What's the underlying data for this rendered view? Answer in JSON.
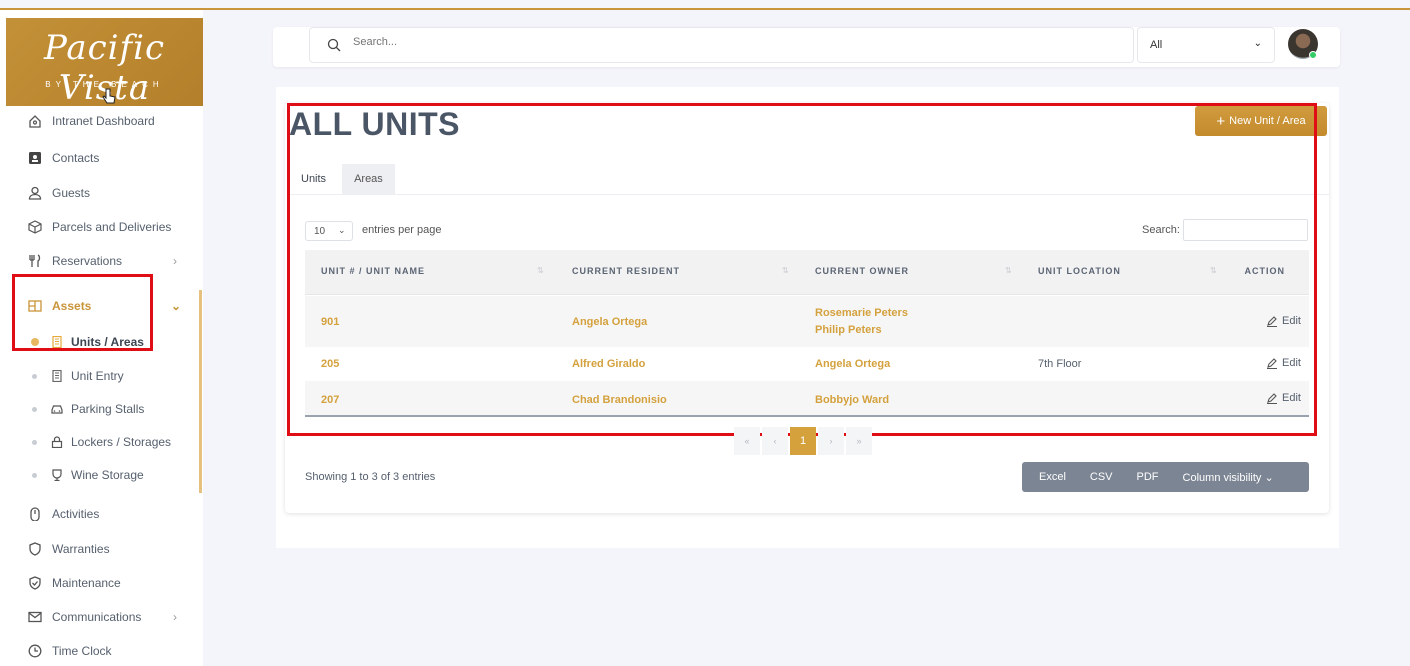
{
  "brand": {
    "name": "Pacific Vista",
    "tagline": "BY THE BEACH"
  },
  "colors": {
    "accent": "#c9953a",
    "highlight": "#e00d15",
    "export_bar": "#7c8593"
  },
  "sidebar": {
    "items": [
      {
        "label": "Intranet Dashboard",
        "icon": "home-icon"
      },
      {
        "label": "Contacts",
        "icon": "contact-card-icon"
      },
      {
        "label": "Guests",
        "icon": "user-icon"
      },
      {
        "label": "Parcels and Deliveries",
        "icon": "package-icon"
      },
      {
        "label": "Reservations",
        "icon": "utensils-icon",
        "chevron": ">"
      },
      {
        "label": "Assets",
        "icon": "assets-icon",
        "chevron": "v",
        "active": true
      },
      {
        "label": "Activities",
        "icon": "activity-icon"
      },
      {
        "label": "Warranties",
        "icon": "shield-icon"
      },
      {
        "label": "Maintenance",
        "icon": "maintenance-icon"
      },
      {
        "label": "Communications",
        "icon": "mail-icon",
        "chevron": ">"
      },
      {
        "label": "Time Clock",
        "icon": "clock-icon"
      }
    ],
    "subitems": [
      {
        "label": "Units / Areas",
        "icon": "building-icon",
        "active": true
      },
      {
        "label": "Unit Entry",
        "icon": "building-icon"
      },
      {
        "label": "Parking Stalls",
        "icon": "car-icon"
      },
      {
        "label": "Lockers / Storages",
        "icon": "lock-icon"
      },
      {
        "label": "Wine Storage",
        "icon": "wine-icon"
      }
    ]
  },
  "topbar": {
    "search_placeholder": "Search...",
    "scope": "All"
  },
  "page": {
    "title": "ALL UNITS",
    "new_button": "New Unit / Area",
    "tabs": [
      "Units",
      "Areas"
    ],
    "entries_value": "10",
    "entries_label": "entries per page",
    "search_label": "Search:"
  },
  "table": {
    "headers": [
      "UNIT # / UNIT NAME",
      "CURRENT RESIDENT",
      "CURRENT OWNER",
      "UNIT LOCATION",
      "ACTION"
    ],
    "rows": [
      {
        "unit": "901",
        "resident": "Angela Ortega",
        "owner1": "Rosemarie Peters",
        "owner2": "Philip Peters",
        "location": "",
        "action": "Edit"
      },
      {
        "unit": "205",
        "resident": "Alfred Giraldo",
        "owner1": "Angela Ortega",
        "owner2": "",
        "location": "7th Floor",
        "action": "Edit"
      },
      {
        "unit": "207",
        "resident": "Chad Brandonisio",
        "owner1": "Bobbyjo Ward",
        "owner2": "",
        "location": "",
        "action": "Edit"
      }
    ]
  },
  "pagination": {
    "first": "«",
    "prev": "‹",
    "current": "1",
    "next": "›",
    "last": "»"
  },
  "footer": {
    "showing": "Showing 1 to 3 of 3 entries",
    "exports": [
      "Excel",
      "CSV",
      "PDF",
      "Column visibility ⌄"
    ]
  }
}
